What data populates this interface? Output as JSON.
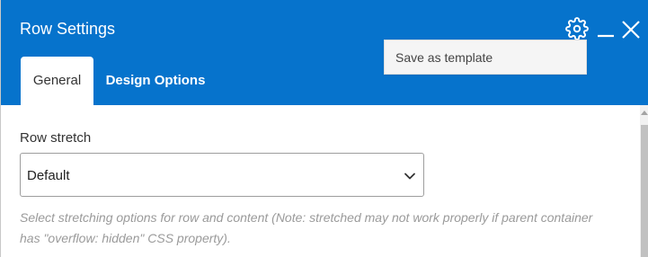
{
  "window": {
    "title": "Row Settings",
    "accent_color": "#0673cc",
    "icons": [
      "gear-icon",
      "minimize-icon",
      "close-icon"
    ]
  },
  "tabs": [
    {
      "label": "General",
      "active": true
    },
    {
      "label": "Design Options",
      "active": false
    }
  ],
  "settings_menu": {
    "items": [
      {
        "label": "Save as template"
      }
    ]
  },
  "form": {
    "row_stretch": {
      "label": "Row stretch",
      "selected_value": "Default",
      "help_text": "Select stretching options for row and content (Note: stretched may not work properly if parent container has \"overflow: hidden\" CSS property)."
    }
  }
}
